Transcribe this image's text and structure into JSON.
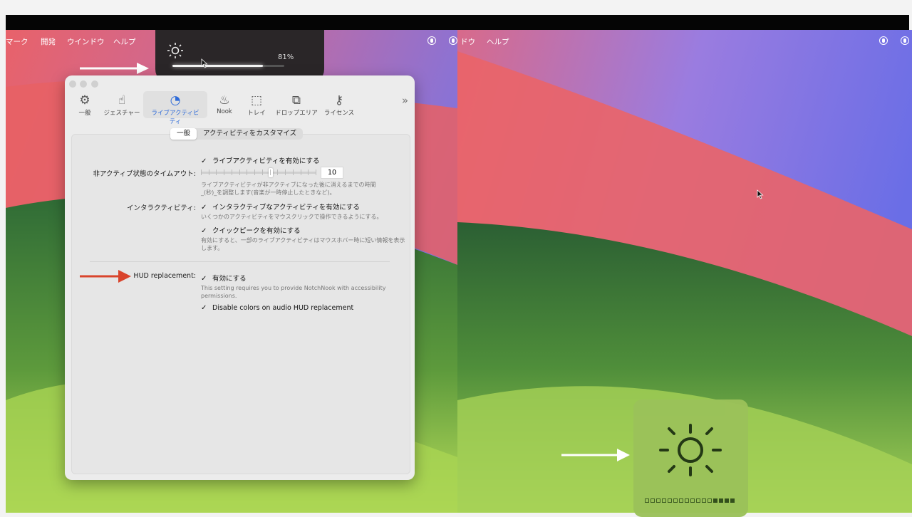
{
  "left_menubar": {
    "items": [
      "マーク",
      "開発",
      "ウインドウ",
      "ヘルプ"
    ]
  },
  "right_menubar": {
    "items": [
      "ドウ",
      "ヘルプ"
    ]
  },
  "notch_hud": {
    "icon": "sun-icon",
    "percent_label": "81%",
    "level": 0.81
  },
  "settings": {
    "toolbar": [
      {
        "label": "一般",
        "icon": "gear-icon"
      },
      {
        "label": "ジェスチャー",
        "icon": "gesture-icon"
      },
      {
        "label": "ライブアクティビティ",
        "icon": "live-activity-icon",
        "active": true
      },
      {
        "label": "Nook",
        "icon": "lamp-icon"
      },
      {
        "label": "トレイ",
        "icon": "tray-icon"
      },
      {
        "label": "ドロップエリア",
        "icon": "drop-area-icon"
      },
      {
        "label": "ライセンス",
        "icon": "key-icon"
      }
    ],
    "more_icon": "chevron-double-right-icon",
    "segments": [
      "一般",
      "アクティビティをカスタマイズ"
    ],
    "live_activity_enable": "ライブアクティビティを有効にする",
    "timeout_label": "非アクティブ状態のタイムアウト:",
    "timeout_value": "10",
    "timeout_help": [
      "ライブアクティビティが非アクティブになった後に消えるまでの時間",
      "_(秒)_を調整します(音楽が一時停止したときなど)。"
    ],
    "interactivity_label": "インタラクティビティ:",
    "interactive_enable": "インタラクティブなアクティビティを有効にする",
    "interactive_help": "いくつかのアクティビティをマウスクリックで操作できるようにする。",
    "quick_peek": "クイックピークを有効にする",
    "quick_peek_help": [
      "有効にすると、一部のライブアクティビティはマウスホバー時に短い情報を表示",
      "します。"
    ],
    "hud_label": "HUD replacement:",
    "hud_enable": "有効にする",
    "hud_help": [
      "This setting requires you to provide NotchNook with accessibility",
      "permissions."
    ],
    "disable_colors": "Disable colors on audio HUD replacement"
  },
  "right_hud": {
    "icon": "sun-icon",
    "level": 0.25
  },
  "colors": {
    "arrow_white": "#ffffff",
    "arrow_red": "#d9442c",
    "accent": "#2f6bd8"
  }
}
